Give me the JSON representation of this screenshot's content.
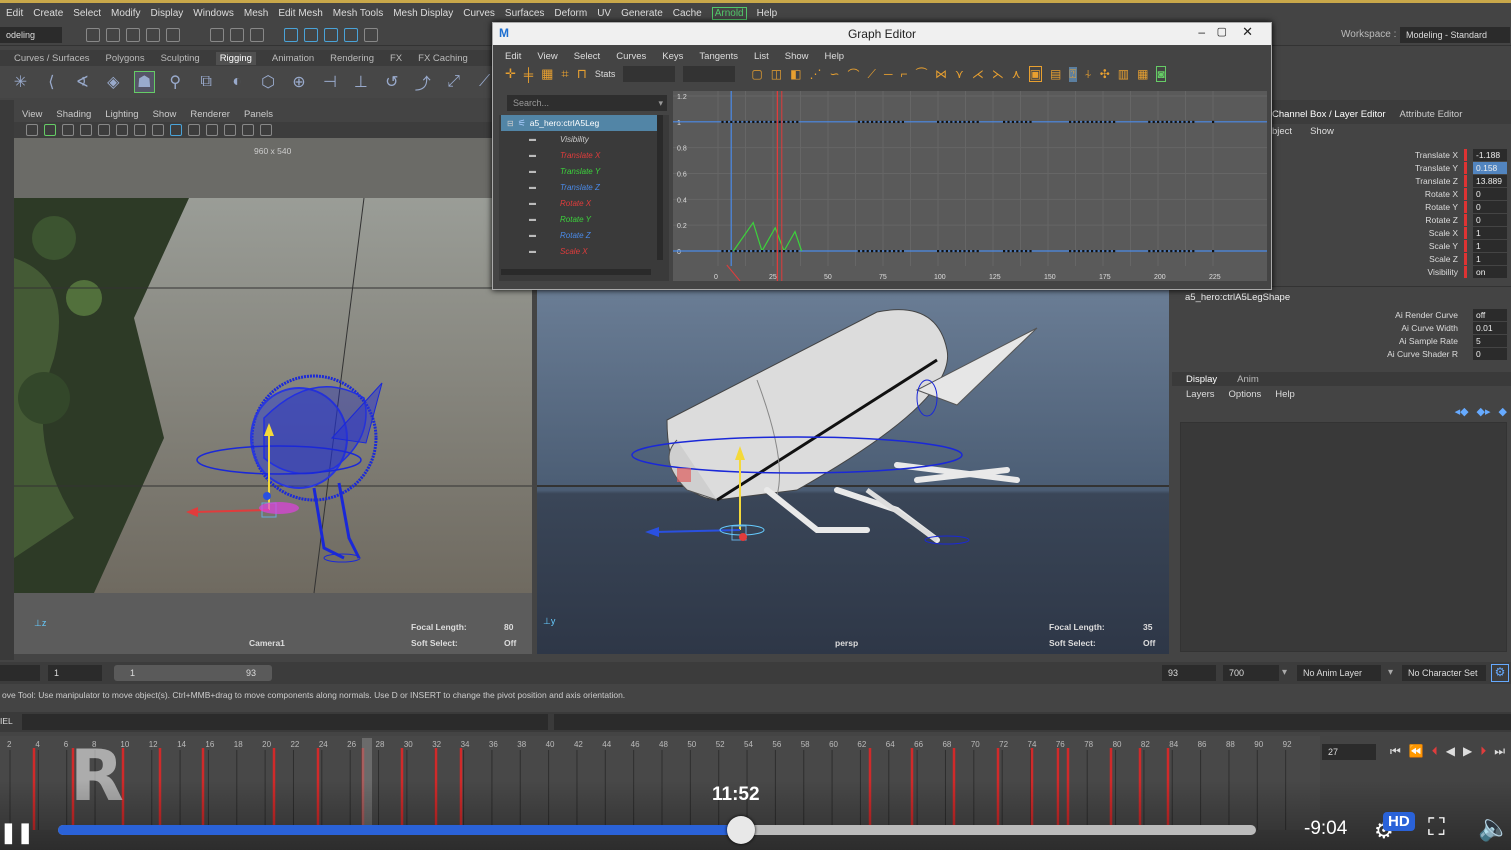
{
  "menubar": {
    "items": [
      "Edit",
      "Create",
      "Select",
      "Modify",
      "Display",
      "Windows",
      "Mesh",
      "Edit Mesh",
      "Mesh Tools",
      "Mesh Display",
      "Curves",
      "Surfaces",
      "Deform",
      "UV",
      "Generate",
      "Cache",
      "Arnold",
      "Help"
    ],
    "workspace_label": "Workspace :",
    "workspace_value": "Modeling - Standard"
  },
  "statusline": {
    "mode": "odeling"
  },
  "shelf": {
    "tabs": [
      "Curves / Surfaces",
      "Polygons",
      "Sculpting",
      "Rigging",
      "Animation",
      "Rendering",
      "FX",
      "FX Caching"
    ],
    "active_tab": "Rigging"
  },
  "viewport_menu": [
    "View",
    "Shading",
    "Lighting",
    "Show",
    "Renderer",
    "Panels"
  ],
  "viewport1": {
    "resolution": "960 x 540",
    "camera": "Camera1",
    "focal_label": "Focal Length:",
    "focal_value": "80",
    "soft_label": "Soft Select:",
    "soft_value": "Off"
  },
  "viewport2": {
    "camera": "persp",
    "focal_label": "Focal Length:",
    "focal_value": "35",
    "soft_label": "Soft Select:",
    "soft_value": "Off"
  },
  "graph_editor": {
    "title": "Graph Editor",
    "menu": [
      "Edit",
      "View",
      "Select",
      "Curves",
      "Keys",
      "Tangents",
      "List",
      "Show",
      "Help"
    ],
    "stats_label": "Stats",
    "search_placeholder": "Search...",
    "node": "a5_hero:ctrlA5Leg",
    "channels": [
      {
        "name": "Visibility",
        "color": "#cccccc"
      },
      {
        "name": "Translate X",
        "color": "#e03c3c"
      },
      {
        "name": "Translate Y",
        "color": "#3cd23c"
      },
      {
        "name": "Translate Z",
        "color": "#4a8ae8"
      },
      {
        "name": "Rotate X",
        "color": "#e03c3c"
      },
      {
        "name": "Rotate Y",
        "color": "#3cd23c"
      },
      {
        "name": "Rotate Z",
        "color": "#4a8ae8"
      },
      {
        "name": "Scale X",
        "color": "#e03c3c"
      }
    ],
    "y_ticks": [
      "1.2",
      "1",
      "0.8",
      "0.6",
      "0.4",
      "0.2",
      "0"
    ],
    "x_ticks": [
      "0",
      "25",
      "50",
      "75",
      "100",
      "125",
      "150",
      "175",
      "200",
      "225"
    ]
  },
  "channel_box": {
    "tabs": [
      "Channel Box / Layer Editor",
      "Attribute Editor"
    ],
    "submenu": [
      "bject",
      "Show"
    ],
    "attrs": [
      {
        "label": "Translate X",
        "value": "-1.188"
      },
      {
        "label": "Translate Y",
        "value": "0.158"
      },
      {
        "label": "Translate Z",
        "value": "13.889"
      },
      {
        "label": "Rotate X",
        "value": "0"
      },
      {
        "label": "Rotate Y",
        "value": "0"
      },
      {
        "label": "Rotate Z",
        "value": "0"
      },
      {
        "label": "Scale X",
        "value": "1"
      },
      {
        "label": "Scale Y",
        "value": "1"
      },
      {
        "label": "Scale Z",
        "value": "1"
      },
      {
        "label": "Visibility",
        "value": "on"
      }
    ],
    "shape_name": "a5_hero:ctrlA5LegShape",
    "shape_attrs": [
      {
        "label": "Ai Render Curve",
        "value": "off"
      },
      {
        "label": "Ai Curve Width",
        "value": "0.01"
      },
      {
        "label": "Ai Sample Rate",
        "value": "5"
      },
      {
        "label": "Ai Curve Shader R",
        "value": "0"
      }
    ],
    "layer_tabs": [
      "Display",
      "Anim"
    ],
    "layer_menu": [
      "Layers",
      "Options",
      "Help"
    ]
  },
  "range": {
    "start": "1",
    "slider_start": "1",
    "slider_end": "93",
    "end": "93",
    "max": "700",
    "anim_layer": "No Anim Layer",
    "char_set": "No Character Set"
  },
  "helpline": "ove Tool: Use manipulator to move object(s). Ctrl+MMB+drag to move components along normals. Use D or INSERT to change the pivot position and axis orientation.",
  "cmd_label": "IEL",
  "timeline": {
    "labels": [
      "2",
      "4",
      "6",
      "8",
      "10",
      "12",
      "14",
      "16",
      "18",
      "20",
      "22",
      "24",
      "26",
      "28",
      "30",
      "32",
      "34",
      "36",
      "38",
      "40",
      "42",
      "44",
      "46",
      "48",
      "50",
      "52",
      "54",
      "56",
      "58",
      "60",
      "62",
      "64",
      "66",
      "68",
      "70",
      "72",
      "74",
      "76",
      "78",
      "80",
      "82",
      "84",
      "86",
      "88",
      "90",
      "92"
    ],
    "current_frame": "27"
  },
  "video": {
    "elapsed": "11:52",
    "remaining": "-9:04",
    "quality": "HD",
    "progress": 0.57
  }
}
